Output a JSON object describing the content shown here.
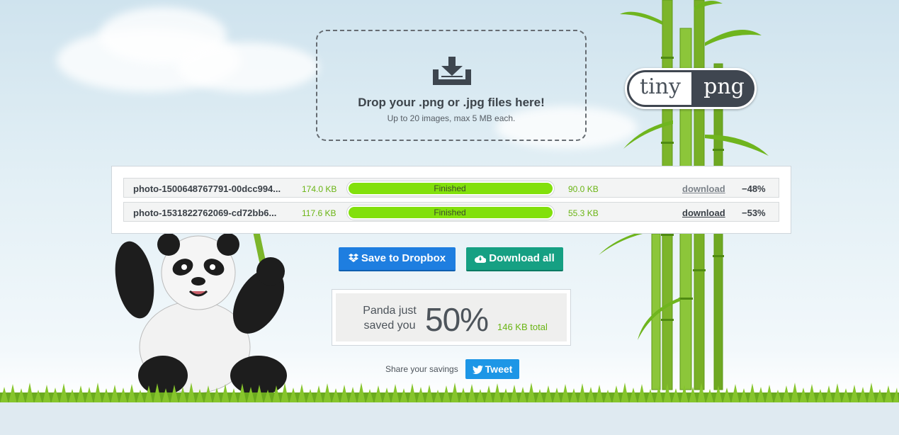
{
  "dropzone": {
    "title": "Drop your .png or .jpg files here!",
    "subtitle": "Up to 20 images, max 5 MB each."
  },
  "logo": {
    "left": "tiny",
    "right": "png"
  },
  "files": [
    {
      "name": "photo-1500648767791-00dcc994...",
      "original_size": "174.0 KB",
      "status": "Finished",
      "progress": 1.0,
      "new_size": "90.0 KB",
      "download_label": "download",
      "reduction": "−48%"
    },
    {
      "name": "photo-1531822762069-cd72bb6...",
      "original_size": "117.6 KB",
      "status": "Finished",
      "progress": 1.0,
      "new_size": "55.3 KB",
      "download_label": "download",
      "reduction": "−53%"
    }
  ],
  "actions": {
    "dropbox_label": "Save to Dropbox",
    "download_all_label": "Download all"
  },
  "savings": {
    "line1": "Panda just",
    "line2": "saved you",
    "percent": "50%",
    "total": "146 KB total"
  },
  "share": {
    "text": "Share your savings",
    "tweet_label": "Tweet"
  },
  "colors": {
    "accent_green": "#82e00c",
    "text_green": "#6ab413",
    "dropbox_blue": "#1e7ee0",
    "download_teal": "#16a083",
    "twitter_blue": "#1d96e6"
  },
  "icons": [
    "download-tray-icon",
    "dropbox-icon",
    "cloud-download-icon",
    "twitter-bird-icon"
  ]
}
